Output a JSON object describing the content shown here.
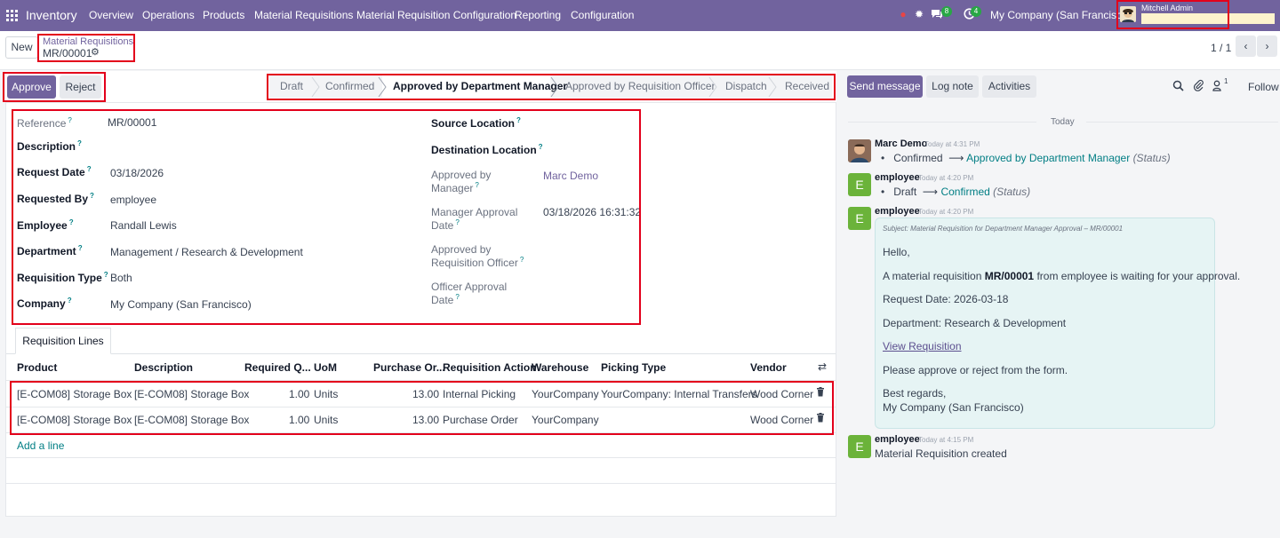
{
  "topnav": {
    "app_name": "Inventory",
    "menus": [
      "Overview",
      "Operations",
      "Products",
      "Material Requisitions",
      "Material Requisition Configuration",
      "Reporting",
      "Configuration"
    ],
    "messages_badge": "8",
    "activities_badge": "4",
    "company": "My Company (San Francisco)",
    "user": "Mitchell Admin",
    "bar_color": "#71639e"
  },
  "control": {
    "new_label": "New",
    "breadcrumb_parent": "Material Requisitions",
    "breadcrumb_current": "MR/00001",
    "pager": "1 / 1"
  },
  "statusbar": {
    "approve_label": "Approve",
    "reject_label": "Reject",
    "stages": [
      "Draft",
      "Confirmed",
      "Approved by Department Manager",
      "Approved by Requisition Officer",
      "Dispatch",
      "Received"
    ],
    "active_stage": "Approved by Department Manager"
  },
  "form": {
    "left": [
      {
        "label": "Reference",
        "value": "MR/00001"
      },
      {
        "label": "Description",
        "value": ""
      },
      {
        "label": "Request Date",
        "value": "03/18/2026"
      },
      {
        "label": "Requested By",
        "value": "employee"
      },
      {
        "label": "Employee",
        "value": "Randall Lewis"
      },
      {
        "label": "Department",
        "value": "Management / Research & Development"
      },
      {
        "label": "Requisition Type",
        "value": "Both"
      },
      {
        "label": "Company",
        "value": "My Company (San Francisco)"
      }
    ],
    "right": [
      {
        "label": "Source Location",
        "value": ""
      },
      {
        "label": "Destination Location",
        "value": ""
      },
      {
        "label": "Approved by Manager",
        "label_line1": "Approved by",
        "label_line2": "Manager",
        "value": "Marc Demo"
      },
      {
        "label": "Manager Approval Date",
        "label_line1": "Manager Approval",
        "label_line2": "Date",
        "value": "03/18/2026 16:31:32"
      },
      {
        "label": "Approved by Requisition Officer",
        "label_line1": "Approved by",
        "label_line2": "Requisition Officer",
        "value": ""
      },
      {
        "label": "Officer Approval Date",
        "label_line1": "Officer Approval",
        "label_line2": "Date",
        "value": ""
      }
    ]
  },
  "lines": {
    "tab_label": "Requisition Lines",
    "columns": [
      "Product",
      "Description",
      "Required Q...",
      "UoM",
      "Purchase Or...",
      "Requisition Action",
      "Warehouse",
      "Picking Type",
      "Vendor"
    ],
    "rows": [
      {
        "product": "[E-COM08] Storage Box",
        "description": "[E-COM08] Storage Box",
        "qty": "1.00",
        "uom": "Units",
        "purchase": "13.00",
        "action": "Internal Picking",
        "warehouse": "YourCompany",
        "picking": "YourCompany: Internal Transfers",
        "vendor": "Wood Corner"
      },
      {
        "product": "[E-COM08] Storage Box",
        "description": "[E-COM08] Storage Box",
        "qty": "1.00",
        "uom": "Units",
        "purchase": "13.00",
        "action": "Purchase Order",
        "warehouse": "YourCompany",
        "picking": "",
        "vendor": "Wood Corner"
      }
    ],
    "add_line": "Add a line"
  },
  "chatter": {
    "send_message": "Send message",
    "log_note": "Log note",
    "activities": "Activities",
    "followers_count": "1",
    "follow": "Follow",
    "day_separator": "Today",
    "messages": [
      {
        "author": "Marc Demo",
        "time": "Today at 4:31 PM",
        "old": "Confirmed",
        "new": "Approved by Department Manager",
        "field": "(Status)"
      },
      {
        "author": "employee",
        "time": "Today at 4:20 PM",
        "old": "Draft",
        "new": "Confirmed",
        "field": "(Status)"
      },
      {
        "author": "employee",
        "time": "Today at 4:20 PM",
        "subject": "Subject: Material Requisition for Department Manager Approval – MR/00001",
        "hello": "Hello,",
        "body_pre": "A material requisition ",
        "body_ref": "MR/00001",
        "body_post": " from employee is waiting for your approval.",
        "request_date": "Request Date: 2026-03-18",
        "department": "Department: Research & Development",
        "view_link": "View Requisition",
        "instruction": "Please approve or reject from the form.",
        "regards": "Best regards,",
        "signature": "My Company (San Francisco)"
      },
      {
        "author": "employee",
        "time": "Today at 4:15 PM",
        "text": "Material Requisition created"
      }
    ]
  }
}
